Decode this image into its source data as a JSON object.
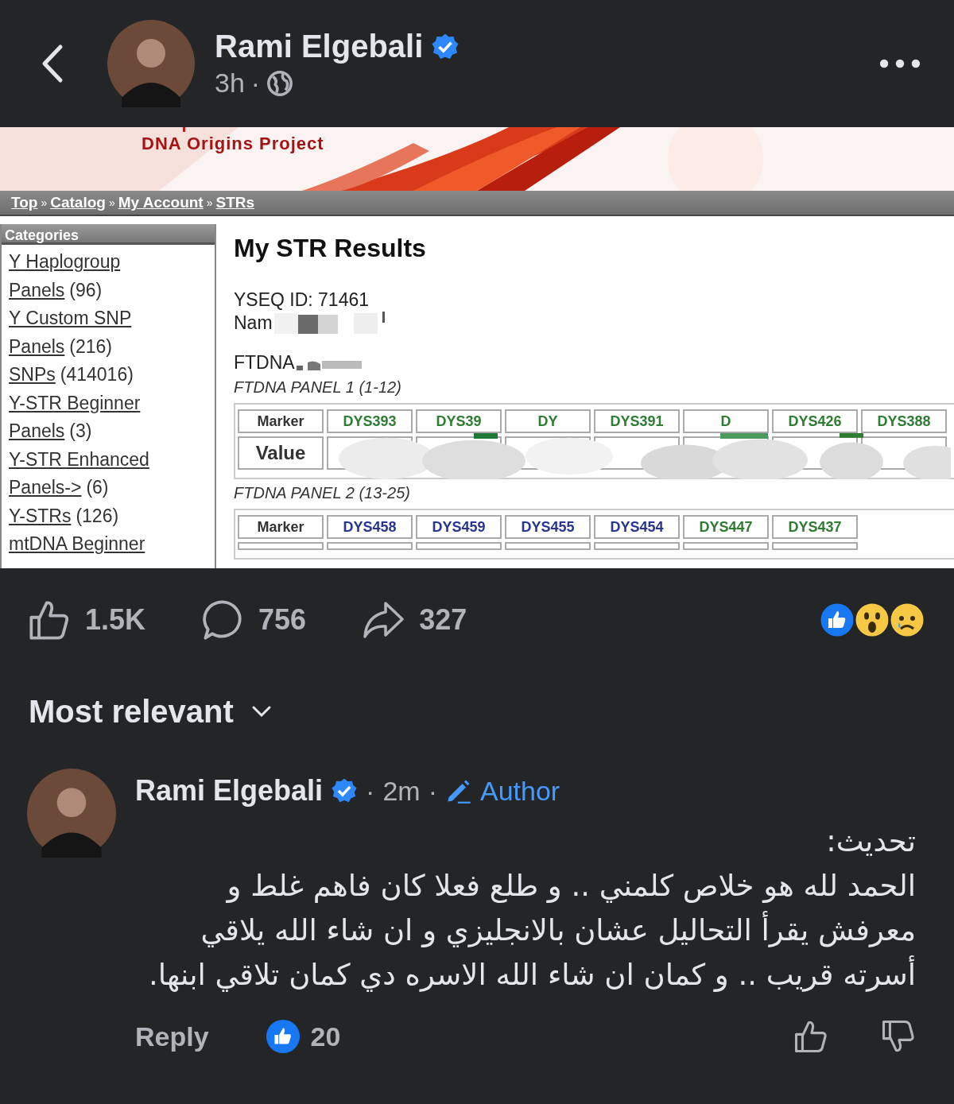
{
  "post": {
    "author": "Rami Elgebali",
    "verified": true,
    "time": "3h",
    "separator": "·"
  },
  "shared_page": {
    "banner_title": "DNA Origins Project",
    "breadcrumb": [
      {
        "label": "Top"
      },
      {
        "label": "Catalog"
      },
      {
        "label": "My Account"
      },
      {
        "label": "STRs"
      }
    ],
    "breadcrumb_separator": "»",
    "sidebar": {
      "title": "Categories",
      "items": [
        {
          "link": "Y Haplogroup"
        },
        {
          "link": "Panels",
          "count": "(96)"
        },
        {
          "link": "Y Custom SNP"
        },
        {
          "link": "Panels",
          "count": "(216)"
        },
        {
          "link": "SNPs",
          "count": "(414016)"
        },
        {
          "link": "Y-STR Beginner"
        },
        {
          "link": "Panels",
          "count": "(3)"
        },
        {
          "link": "Y-STR Enhanced"
        },
        {
          "link": "Panels->",
          "count": "(6)"
        },
        {
          "link": "Y-STRs",
          "count": "(126)"
        },
        {
          "link": "mtDNA Beginner"
        }
      ]
    },
    "heading": "My STR Results",
    "id_line": "YSEQ ID: 71461",
    "name_label": "Nam",
    "ftdna_label": "FTDNA",
    "panels": [
      {
        "title": "FTDNA PANEL 1 (1-12)",
        "marker_label": "Marker",
        "value_label": "Value",
        "markers": [
          {
            "name": "DYS393",
            "color": "#2e7d32"
          },
          {
            "name": "DYS39",
            "color": "#2e7d32"
          },
          {
            "name": "DY",
            "color": "#2e7d32"
          },
          {
            "name": "DYS391",
            "color": "#2e7d32"
          },
          {
            "name": "D",
            "color": "#2e7d32"
          },
          {
            "name": "DYS426",
            "color": "#2e7d32"
          },
          {
            "name": "DYS388",
            "color": "#2e7d32"
          }
        ]
      },
      {
        "title": "FTDNA PANEL 2 (13-25)",
        "marker_label": "Marker",
        "markers": [
          {
            "name": "DYS458",
            "color": "#283593"
          },
          {
            "name": "DYS459",
            "color": "#283593"
          },
          {
            "name": "DYS455",
            "color": "#283593"
          },
          {
            "name": "DYS454",
            "color": "#283593"
          },
          {
            "name": "DYS447",
            "color": "#2e7d32"
          },
          {
            "name": "DYS437",
            "color": "#2e7d32"
          }
        ]
      }
    ]
  },
  "actions": [
    {
      "kind": "like",
      "count": "1.5K"
    },
    {
      "kind": "comment",
      "count": "756"
    },
    {
      "kind": "share",
      "count": "327"
    }
  ],
  "reactions": [
    {
      "kind": "like"
    },
    {
      "kind": "wow"
    },
    {
      "kind": "sad"
    }
  ],
  "sort": {
    "label": "Most relevant"
  },
  "comment": {
    "author": "Rami Elgebali",
    "verified": true,
    "time": "2m",
    "badge": "Author",
    "separator": "·",
    "heading": "تحديث:",
    "body": "الحمد لله هو خلاص كلمني .. و طلع فعلا كان فاهم غلط و معرفش يقرأ التحاليل عشان بالانجليزي و ان شاء الله يلاقي أسرته قريب .. و كمان ان شاء الله الاسره دي كمان تلاقي ابنها.",
    "reply_label": "Reply",
    "like_count": "20"
  }
}
